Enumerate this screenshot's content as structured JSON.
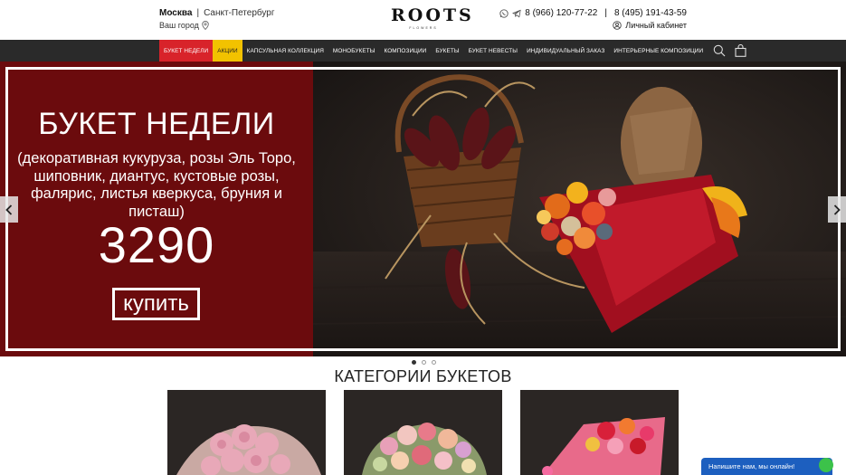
{
  "header": {
    "city_active": "Москва",
    "city_other": "Санкт-Петербург",
    "your_city": "Ваш город",
    "logo_text": "ROOTS",
    "logo_sub": "FLOWERS",
    "phone1": "8 (966) 120-77-22",
    "phone2": "8 (495) 191-43-59",
    "account": "Личный кабинет"
  },
  "nav": {
    "items": [
      {
        "label": "БУКЕТ НЕДЕЛИ"
      },
      {
        "label": "АКЦИИ"
      },
      {
        "label": "КАПСУЛЬНАЯ КОЛЛЕКЦИЯ"
      },
      {
        "label": "МОНОБУКЕТЫ"
      },
      {
        "label": "КОМПОЗИЦИИ"
      },
      {
        "label": "БУКЕТЫ"
      },
      {
        "label": "БУКЕТ НЕВЕСТЫ"
      },
      {
        "label": "ИНДИВИДУАЛЬНЫЙ ЗАКАЗ"
      },
      {
        "label": "ИНТЕРЬЕРНЫЕ КОМПОЗИЦИИ"
      }
    ],
    "icons": [
      "search-icon",
      "cart-icon"
    ]
  },
  "hero": {
    "title": "БУКЕТ НЕДЕЛИ",
    "description": "(декоративная кукуруза, розы Эль Торо, шиповник, диантус, кустовые розы, фалярис, листья кверкуса, бруния и писташ)",
    "price": "3290",
    "buy_label": "купить",
    "slides_total": 3,
    "slide_active": 1
  },
  "categories": {
    "title": "КАТЕГОРИИ БУКЕТОВ"
  },
  "chat": {
    "label": "Напишите нам, мы онлайн!"
  },
  "colors": {
    "hero_panel": "#6b0b0d",
    "nav_bg": "#2a2a2a",
    "nav_red": "#d8232a",
    "nav_yellow": "#f2c200",
    "chat_blue": "#1d5fbf"
  }
}
